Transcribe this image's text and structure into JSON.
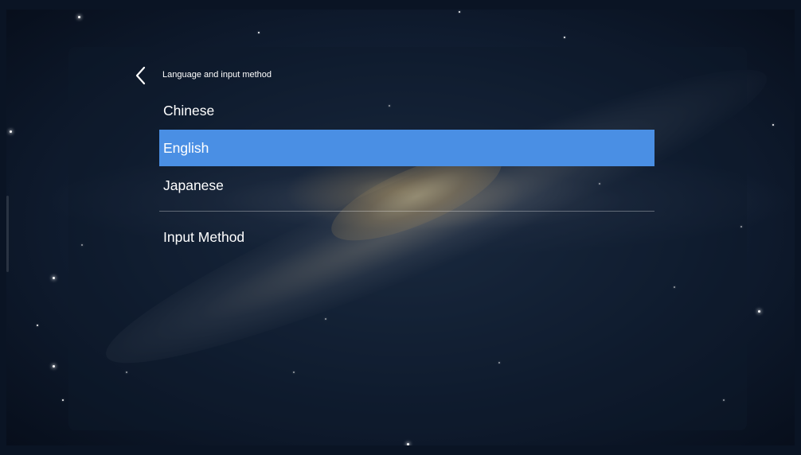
{
  "header": {
    "back_icon": "chevron-left-icon",
    "title": "Language and input method"
  },
  "languages": {
    "selected": "English",
    "items": [
      {
        "label": "Chinese"
      },
      {
        "label": "English"
      },
      {
        "label": "Japanese"
      }
    ]
  },
  "input_method": {
    "label": "Input Method"
  },
  "colors": {
    "selection": "#4a8fe4",
    "text": "#ffffff",
    "divider": "rgba(255,255,255,0.32)"
  }
}
